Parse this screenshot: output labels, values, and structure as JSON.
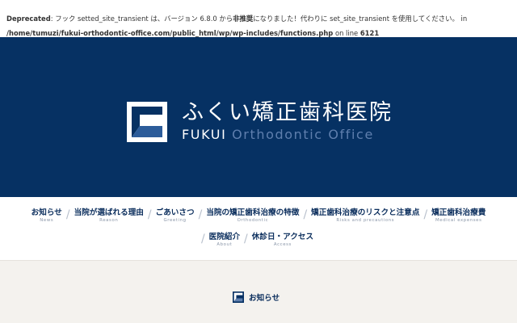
{
  "notice": {
    "line1_label": "Deprecated",
    "line1_text": ": フック setted_site_transient は、バージョン 6.8.0 から",
    "line1_strong": "非推奨",
    "line1_text2": "になりました！代わりに set_site_transient を使用してください。 in",
    "path": "/home/tumuzi/fukui-orthodontic-office.com/public_html/wp/wp-includes/functions.php",
    "on_line": " on line ",
    "line_no": "6121"
  },
  "header": {
    "title": "ふくい矯正歯科医院",
    "sub_en1": "FUKUI",
    "sub_en2": " Orthodontic Office",
    "brand_color": "#063163"
  },
  "nav": {
    "row1": [
      {
        "jp": "お知らせ",
        "en": "News"
      },
      {
        "jp": "当院が選ばれる理由",
        "en": "Reason"
      },
      {
        "jp": "ごあいさつ",
        "en": "Greeting"
      },
      {
        "jp": "当院の矯正歯科治療の特徴",
        "en": "Orthodontic"
      },
      {
        "jp": "矯正歯科治療のリスクと注意点",
        "en": "Risks and precautions"
      },
      {
        "jp": "矯正歯科治療費",
        "en": "Medical expenses"
      }
    ],
    "row2": [
      {
        "jp": "医院紹介",
        "en": "About"
      },
      {
        "jp": "休診日・アクセス",
        "en": "Access"
      }
    ]
  },
  "news": {
    "heading": "お知らせ"
  }
}
